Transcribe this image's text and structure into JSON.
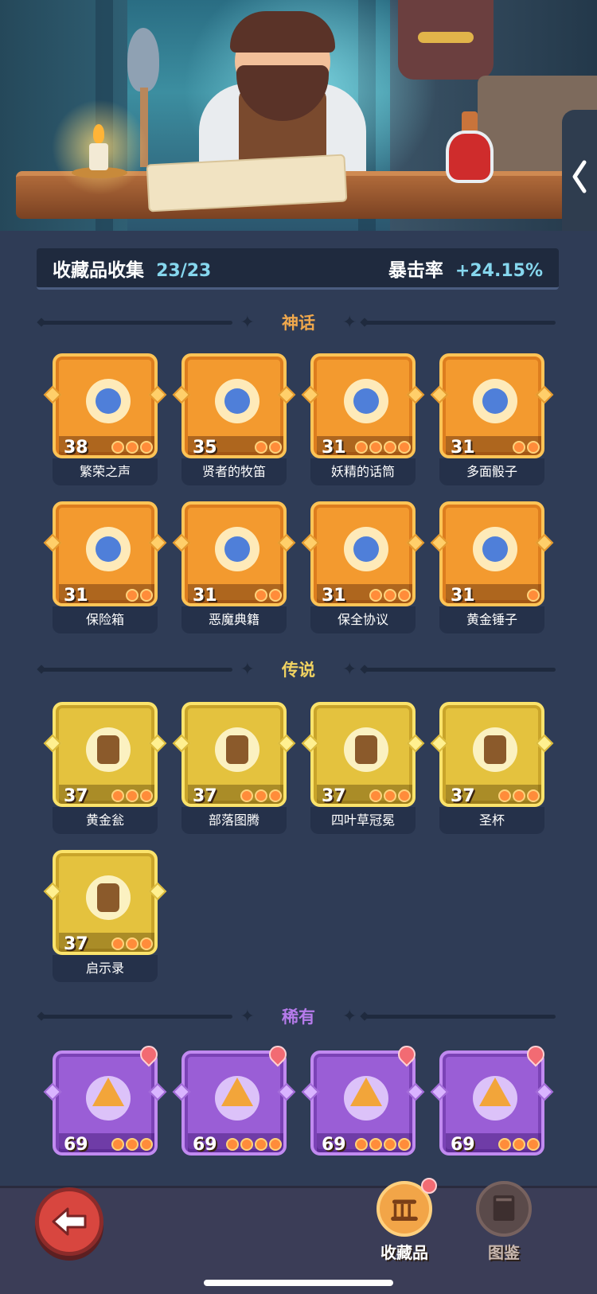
{
  "stats": {
    "collection_label": "收藏品收集",
    "collection_value": "23/23",
    "crit_label": "暴击率",
    "crit_value": "+24.15%"
  },
  "sections": {
    "mythic": "神话",
    "legendary": "传说",
    "rare": "稀有"
  },
  "mythic_items": [
    {
      "name": "繁荣之声",
      "level": "38",
      "stars": 3,
      "icon": "blue-swirl-spirit-icon"
    },
    {
      "name": "贤者的牧笛",
      "level": "35",
      "stars": 2,
      "icon": "flute-icon"
    },
    {
      "name": "妖精的话筒",
      "level": "31",
      "stars": 4,
      "icon": "fairy-microphone-icon"
    },
    {
      "name": "多面骰子",
      "level": "31",
      "stars": 2,
      "icon": "d20-dice-icon"
    },
    {
      "name": "保险箱",
      "level": "31",
      "stars": 2,
      "icon": "treasure-chest-icon"
    },
    {
      "name": "恶魔典籍",
      "level": "31",
      "stars": 2,
      "icon": "demon-book-icon"
    },
    {
      "name": "保全协议",
      "level": "31",
      "stars": 3,
      "icon": "scroll-contract-icon"
    },
    {
      "name": "黄金锤子",
      "level": "31",
      "stars": 1,
      "icon": "golden-hammer-icon"
    }
  ],
  "legendary_items": [
    {
      "name": "黄金瓮",
      "level": "37",
      "stars": 3,
      "icon": "golden-urn-icon"
    },
    {
      "name": "部落图腾",
      "level": "37",
      "stars": 3,
      "icon": "tribal-totem-icon"
    },
    {
      "name": "四叶草冠冕",
      "level": "37",
      "stars": 3,
      "icon": "clover-crown-icon"
    },
    {
      "name": "圣杯",
      "level": "37",
      "stars": 3,
      "icon": "holy-grail-icon"
    },
    {
      "name": "启示录",
      "level": "37",
      "stars": 3,
      "icon": "open-book-icon"
    }
  ],
  "rare_items": [
    {
      "level": "69",
      "stars": 3,
      "icon": "stone-axe-icon"
    },
    {
      "level": "69",
      "stars": 4,
      "icon": "phoenix-feather-icon"
    },
    {
      "level": "69",
      "stars": 4,
      "icon": "skull-dagger-icon"
    },
    {
      "level": "69",
      "stars": 3,
      "icon": "lightning-gem-icon"
    }
  ],
  "nav": {
    "collection": "收藏品",
    "codex": "图鉴"
  },
  "colors": {
    "mythic": "#f39a2f",
    "legendary": "#e4c23e",
    "rare": "#9a5ed6",
    "crit_value": "#86d7ee"
  }
}
